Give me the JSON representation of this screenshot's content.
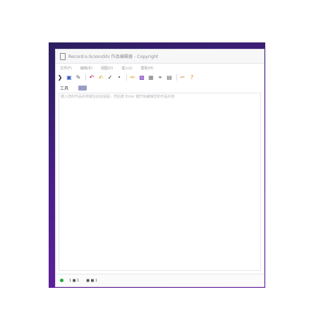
{
  "window": {
    "title": "Record:s-ScionsShi 作品编辑器 - Copyright"
  },
  "menu": {
    "items": [
      "文件(F)",
      "编辑(E)",
      "视图(V)",
      "插入(I)",
      "帮助(H)"
    ]
  },
  "toolbar": {
    "buttons": [
      {
        "name": "arrow-icon",
        "glyph": "❯",
        "color": "#222222"
      },
      {
        "name": "screen-icon",
        "glyph": "▣",
        "color": "#3a57c4"
      },
      {
        "name": "tools-icon",
        "glyph": "✎",
        "color": "#555555"
      },
      {
        "name": "undo-icon",
        "glyph": "↶",
        "color": "#c0163a"
      },
      {
        "name": "brush-icon",
        "glyph": "✍",
        "color": "#d4a017"
      },
      {
        "name": "pen-icon",
        "glyph": "✓",
        "color": "#222222"
      },
      {
        "name": "dot-icon",
        "glyph": "•",
        "color": "#666666"
      },
      {
        "name": "edit-icon",
        "glyph": "✏",
        "color": "#d4a017"
      },
      {
        "name": "image-icon",
        "glyph": "▩",
        "color": "#7b3fb8"
      },
      {
        "name": "frame-icon",
        "glyph": "▦",
        "color": "#777777"
      },
      {
        "name": "link-icon",
        "glyph": "⚭",
        "color": "#777777"
      },
      {
        "name": "save-icon",
        "glyph": "▤",
        "color": "#666666"
      },
      {
        "name": "boot-icon",
        "glyph": "⌐",
        "color": "#c67a14"
      },
      {
        "name": "help-icon",
        "glyph": "?",
        "color": "#d48a14"
      }
    ]
  },
  "subbar": {
    "label": "工具"
  },
  "editor": {
    "first_line": "键入您的作品名称或在此处粘贴，然后按 Enter 键开始编辑您的作品内容"
  },
  "status": {
    "indicator_color": "#22aa33",
    "items": [
      "1 ■ 1",
      "■ ■ 1"
    ]
  }
}
